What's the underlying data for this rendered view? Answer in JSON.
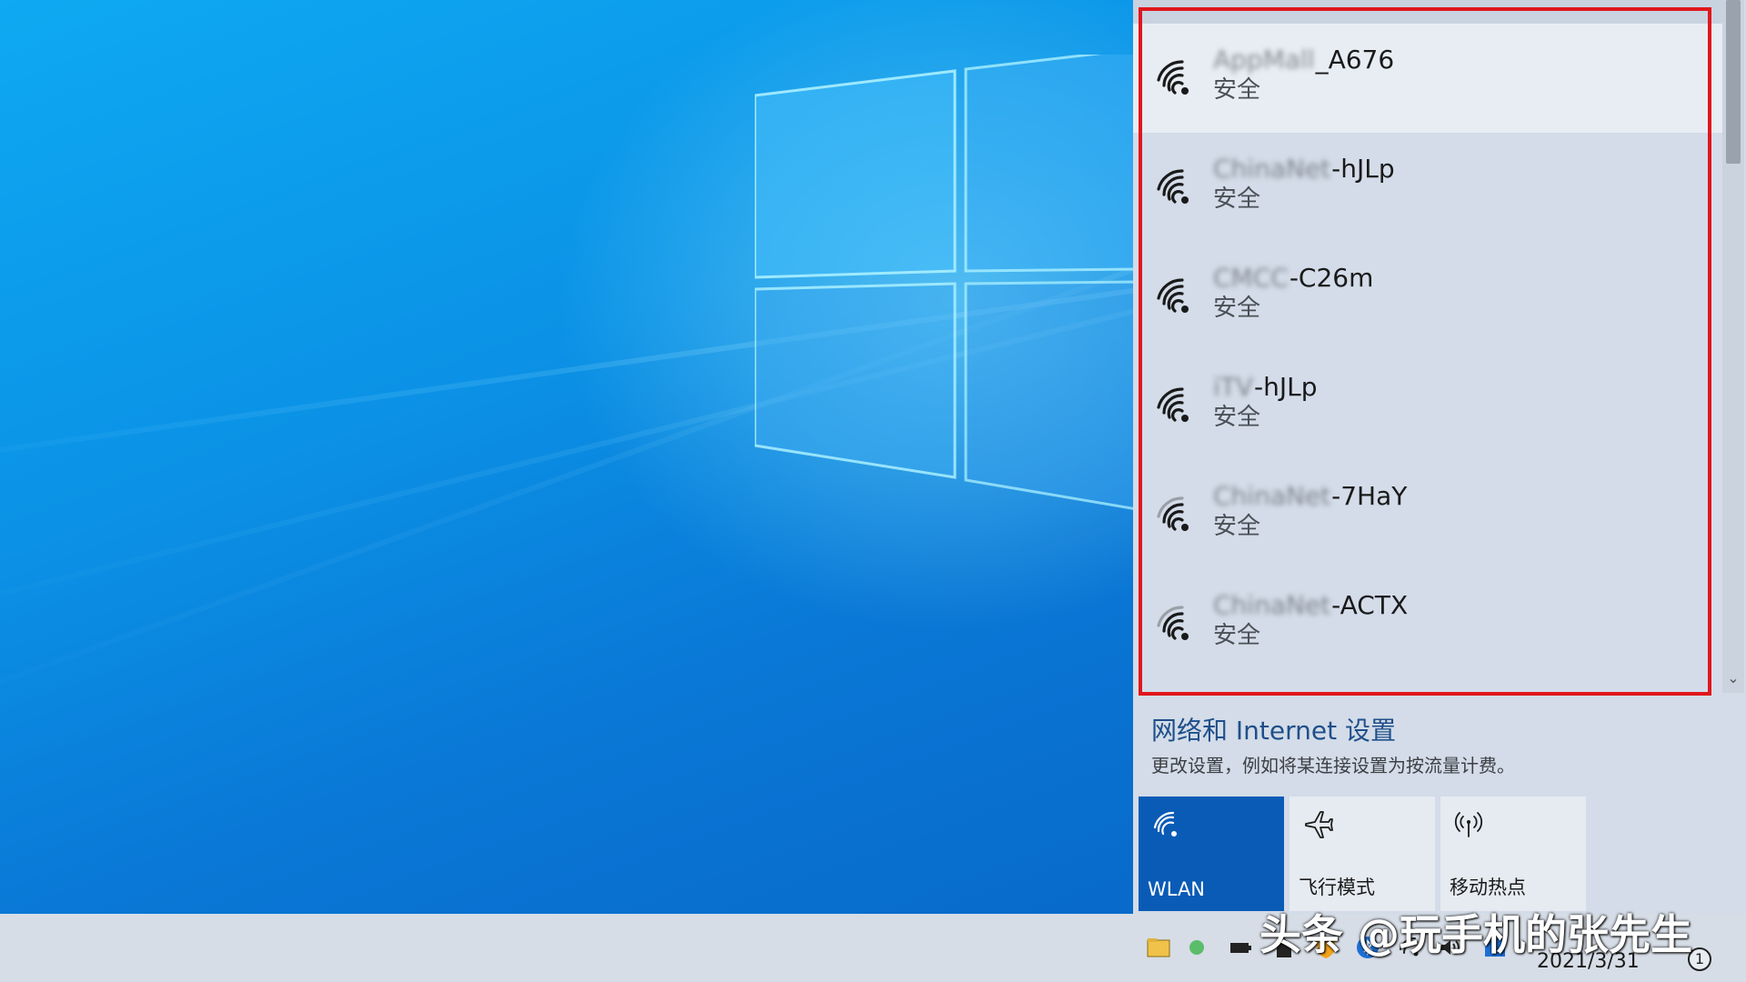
{
  "networks": [
    {
      "prefix": "AppMall",
      "suffix": "_A676",
      "security": "安全"
    },
    {
      "prefix": "ChinaNet",
      "suffix": "-hJLp",
      "security": "安全"
    },
    {
      "prefix": "CMCC",
      "suffix": "-C26m",
      "security": "安全"
    },
    {
      "prefix": "iTV",
      "suffix": "-hJLp",
      "security": "安全"
    },
    {
      "prefix": "ChinaNet",
      "suffix": "-7HaY",
      "security": "安全"
    },
    {
      "prefix": "ChinaNet",
      "suffix": "-ACTX",
      "security": "安全"
    }
  ],
  "settings": {
    "link": "网络和 Internet 设置",
    "desc": "更改设置，例如将某连接设置为按流量计费。"
  },
  "tiles": [
    {
      "label": "WLAN",
      "icon": "wifi-icon",
      "active": true
    },
    {
      "label": "飞行模式",
      "icon": "airplane-icon",
      "active": false
    },
    {
      "label": "移动热点",
      "icon": "hotspot-icon",
      "active": false
    }
  ],
  "taskbar": {
    "date": "2021/3/31",
    "notification_count": "1"
  },
  "watermark": "头条 @玩手机的张先生",
  "colors": {
    "accent": "#0a5bb6",
    "highlight_box": "#e0171c"
  }
}
